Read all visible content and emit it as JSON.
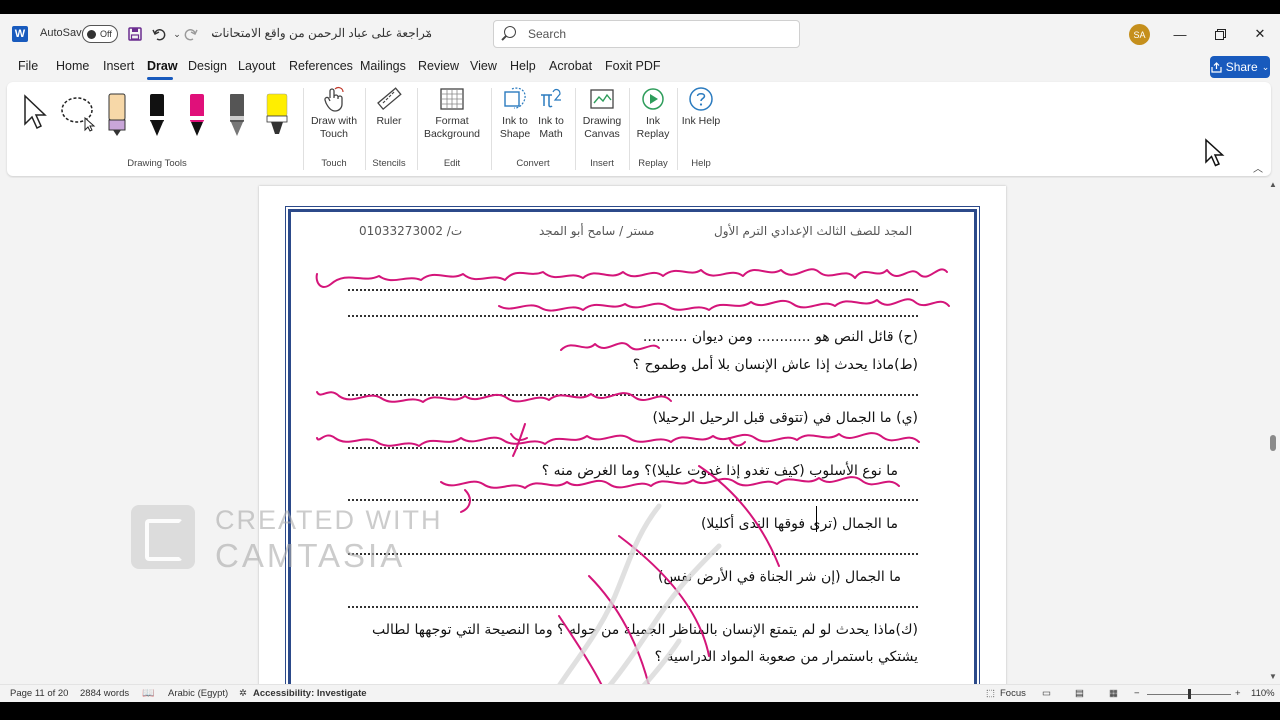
{
  "titlebar": {
    "autosave_label": "AutoSave",
    "autosave_state": "Off",
    "document_title": "مراجعة على عباد الرحمن من واقع الامتحانات",
    "search_placeholder": "Search",
    "user_initials": "SA"
  },
  "menu": {
    "items": [
      "File",
      "Home",
      "Insert",
      "Draw",
      "Design",
      "Layout",
      "References",
      "Mailings",
      "Review",
      "View",
      "Help",
      "Acrobat",
      "Foxit PDF"
    ],
    "active": "Draw",
    "share_label": "Share"
  },
  "ribbon": {
    "groups": {
      "drawing_tools": "Drawing Tools",
      "touch": "Touch",
      "stencils": "Stencils",
      "edit": "Edit",
      "convert": "Convert",
      "insert": "Insert",
      "replay": "Replay",
      "help": "Help"
    },
    "buttons": {
      "draw_with_touch": "Draw with Touch",
      "ruler": "Ruler",
      "format_background": "Format Background",
      "ink_to_shape": "Ink to Shape",
      "ink_to_math": "Ink to Math",
      "drawing_canvas": "Drawing Canvas",
      "ink_replay": "Ink Replay",
      "ink_help": "Ink Help"
    },
    "pen_colors": [
      "#f7d8a8",
      "#111111",
      "#e0107a",
      "#4a4a4a",
      "#ffee00"
    ]
  },
  "document": {
    "header": {
      "left": "ت/ 01033273002",
      "center": "مستر / سامح أبو المجد",
      "right": "المجد للصف الثالث الإعدادي الترم الأول"
    },
    "questions": [
      "(ح) قائل النص هو ............ ومن ديوان ..........",
      "(ط)ماذا يحدث إذا عاش الإنسان بلا أمل وطموح ؟",
      "(ي) ما الجمال في (تتوقى قبل الرحيل الرحيلا)",
      "ما نوع الأسلوب (كيف تغدو إذا غدوت عليلا)؟ وما الغرض منه ؟",
      "ما الجمال (ترى فوقها الندى أكليلا)",
      "ما الجمال (إن شر الجناة في الأرض نفس)",
      "(ك)ماذا يحدث لو لم يتمتع الإنسان بالمناظر الجميلة من حوله ؟ وما النصيحة التي توجهها لطالب",
      "يشتكي باستمرار من صعوبة المواد الدراسية ؟"
    ],
    "ink_color": "#d4157a"
  },
  "watermark": {
    "line1": "CREATED WITH",
    "line2": "CAMTASIA"
  },
  "statusbar": {
    "page": "Page 11 of 20",
    "words": "2884 words",
    "language": "Arabic (Egypt)",
    "accessibility": "Accessibility: Investigate",
    "focus": "Focus",
    "zoom": "110%",
    "zoom_minus": "−",
    "zoom_plus": "+"
  }
}
